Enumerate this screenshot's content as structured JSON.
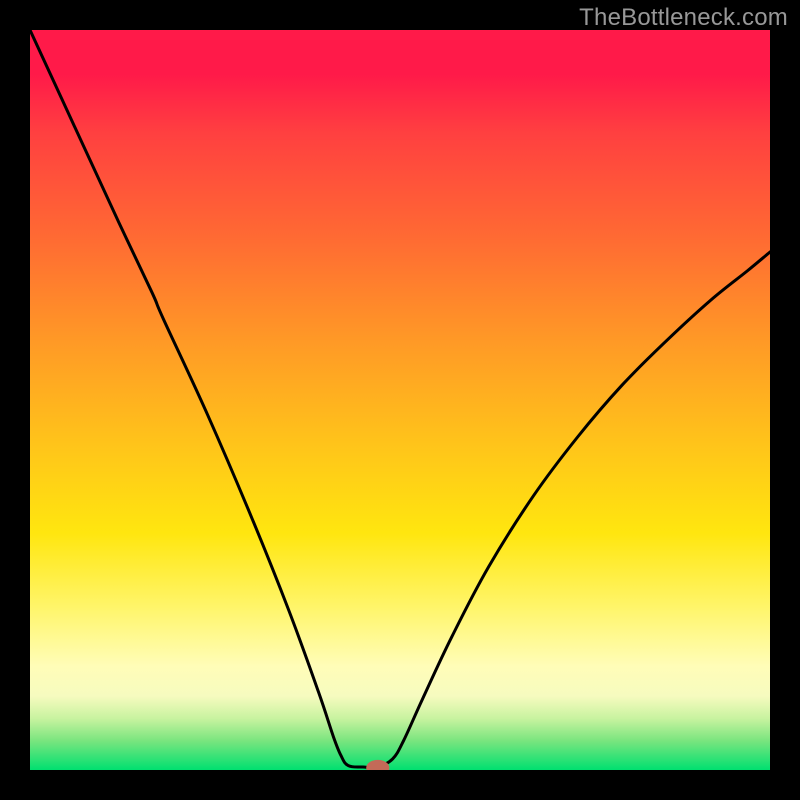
{
  "watermark": "TheBottleneck.com",
  "chart_data": {
    "type": "line",
    "title": "",
    "xlabel": "",
    "ylabel": "",
    "xlim": [
      0,
      1
    ],
    "ylim": [
      0,
      1
    ],
    "grid": false,
    "series": [
      {
        "name": "curve",
        "stroke": "#000000",
        "points": [
          {
            "x": 0.0,
            "y": 1.0
          },
          {
            "x": 0.06,
            "y": 0.87
          },
          {
            "x": 0.12,
            "y": 0.74
          },
          {
            "x": 0.165,
            "y": 0.645
          },
          {
            "x": 0.18,
            "y": 0.61
          },
          {
            "x": 0.24,
            "y": 0.48
          },
          {
            "x": 0.3,
            "y": 0.34
          },
          {
            "x": 0.35,
            "y": 0.215
          },
          {
            "x": 0.39,
            "y": 0.105
          },
          {
            "x": 0.41,
            "y": 0.045
          },
          {
            "x": 0.42,
            "y": 0.02
          },
          {
            "x": 0.43,
            "y": 0.006
          },
          {
            "x": 0.45,
            "y": 0.004
          },
          {
            "x": 0.47,
            "y": 0.004
          },
          {
            "x": 0.49,
            "y": 0.015
          },
          {
            "x": 0.505,
            "y": 0.04
          },
          {
            "x": 0.53,
            "y": 0.095
          },
          {
            "x": 0.57,
            "y": 0.18
          },
          {
            "x": 0.62,
            "y": 0.275
          },
          {
            "x": 0.68,
            "y": 0.37
          },
          {
            "x": 0.74,
            "y": 0.45
          },
          {
            "x": 0.8,
            "y": 0.52
          },
          {
            "x": 0.86,
            "y": 0.58
          },
          {
            "x": 0.92,
            "y": 0.635
          },
          {
            "x": 0.97,
            "y": 0.675
          },
          {
            "x": 1.0,
            "y": 0.7
          }
        ]
      }
    ],
    "marker": {
      "x": 0.47,
      "y": 0.003,
      "rx": 0.015,
      "ry": 0.01,
      "fill": "#c36a58"
    }
  }
}
